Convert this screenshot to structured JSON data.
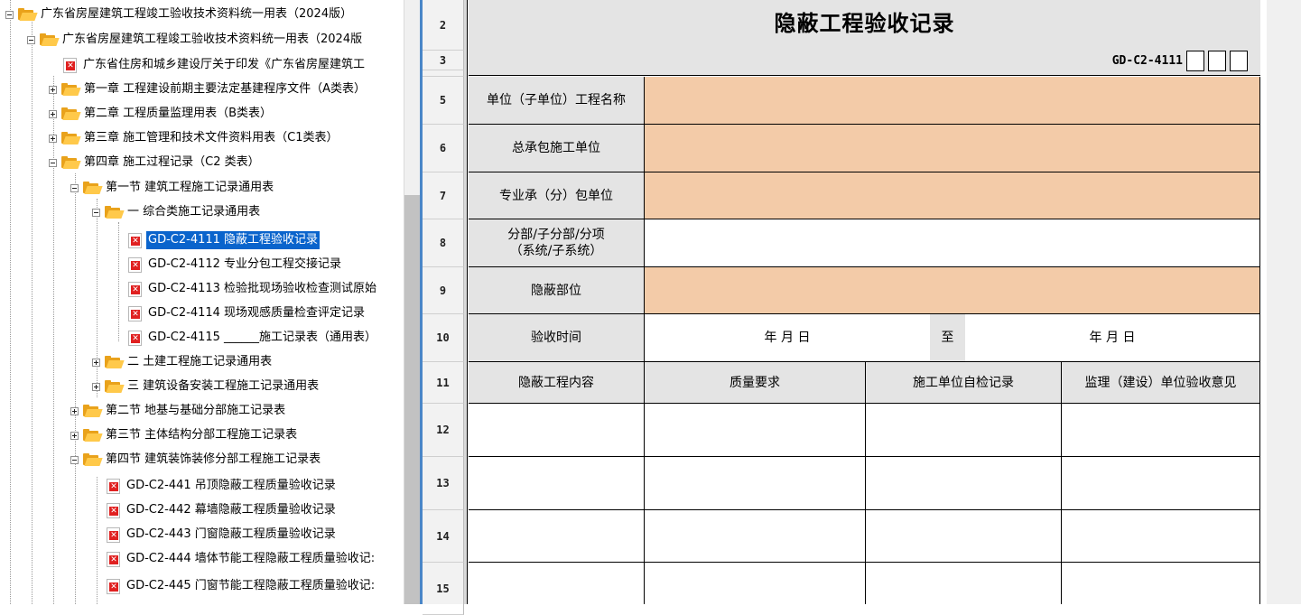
{
  "tree": {
    "items": [
      {
        "label": "广东省房屋建筑工程竣工验收技术资料统一用表（2024版）",
        "type": "folder"
      },
      {
        "label": "广东省房屋建筑工程竣工验收技术资料统一用表（2024版",
        "type": "folder"
      },
      {
        "label": "广东省住房和城乡建设厅关于印发《广东省房屋建筑工",
        "type": "pdf"
      },
      {
        "label": "第一章 工程建设前期主要法定基建程序文件（A类表）",
        "type": "folder"
      },
      {
        "label": "第二章 工程质量监理用表（B类表）",
        "type": "folder"
      },
      {
        "label": "第三章 施工管理和技术文件资料用表（C1类表）",
        "type": "folder"
      },
      {
        "label": "第四章 施工过程记录（C2 类表）",
        "type": "folder"
      },
      {
        "label": "第一节 建筑工程施工记录通用表",
        "type": "folder"
      },
      {
        "label": "一 综合类施工记录通用表",
        "type": "folder"
      },
      {
        "label": "GD-C2-4111 隐蔽工程验收记录",
        "type": "pdf",
        "selected": true
      },
      {
        "label": "GD-C2-4112 专业分包工程交接记录",
        "type": "pdf"
      },
      {
        "label": "GD-C2-4113 检验批现场验收检查测试原始",
        "type": "pdf"
      },
      {
        "label": "GD-C2-4114 现场观感质量检查评定记录",
        "type": "pdf"
      },
      {
        "label": "GD-C2-4115 ______施工记录表（通用表）",
        "type": "pdf"
      },
      {
        "label": "二 土建工程施工记录通用表",
        "type": "folder"
      },
      {
        "label": "三 建筑设备安装工程施工记录通用表",
        "type": "folder"
      },
      {
        "label": "第二节 地基与基础分部施工记录表",
        "type": "folder"
      },
      {
        "label": "第三节 主体结构分部工程施工记录表",
        "type": "folder"
      },
      {
        "label": "第四节 建筑装饰装修分部工程施工记录表",
        "type": "folder"
      },
      {
        "label": "GD-C2-441 吊顶隐蔽工程质量验收记录",
        "type": "pdf"
      },
      {
        "label": "GD-C2-442 幕墙隐蔽工程质量验收记录",
        "type": "pdf"
      },
      {
        "label": "GD-C2-443 门窗隐蔽工程质量验收记录",
        "type": "pdf"
      },
      {
        "label": "GD-C2-444 墙体节能工程隐蔽工程质量验收记:",
        "type": "pdf"
      },
      {
        "label": "GD-C2-445 门窗节能工程隐蔽工程质量验收记:",
        "type": "pdf"
      }
    ],
    "icons": {
      "folder": "open-folder-icon",
      "pdf": "pdf-file-icon"
    },
    "selected_color": "#0a64cc"
  },
  "sheet": {
    "row_numbers": [
      "2",
      "3",
      "5",
      "6",
      "7",
      "8",
      "9",
      "10",
      "11",
      "12",
      "13",
      "14",
      "15"
    ],
    "title": "隐蔽工程验收记录",
    "form_code": "GD-C2-4111",
    "labels": {
      "project_name": "单位（子单位）工程名称",
      "general_contractor": "总承包施工单位",
      "subcontractor": "专业承（分）包单位",
      "division_line1": "分部/子分部/分项",
      "division_line2": "（系统/子系统）",
      "concealed_part": "隐蔽部位",
      "inspection_time": "验收时间",
      "date_from": "年  月  日",
      "to": "至",
      "date_to": "年  月  日"
    },
    "columns": [
      "隐蔽工程内容",
      "质量要求",
      "施工单位自检记录",
      "监理（建设）单位验收意见"
    ],
    "colors": {
      "label_bg": "#e4e4e4",
      "input_bg": "#f3cba8",
      "grid": "#000000"
    }
  }
}
